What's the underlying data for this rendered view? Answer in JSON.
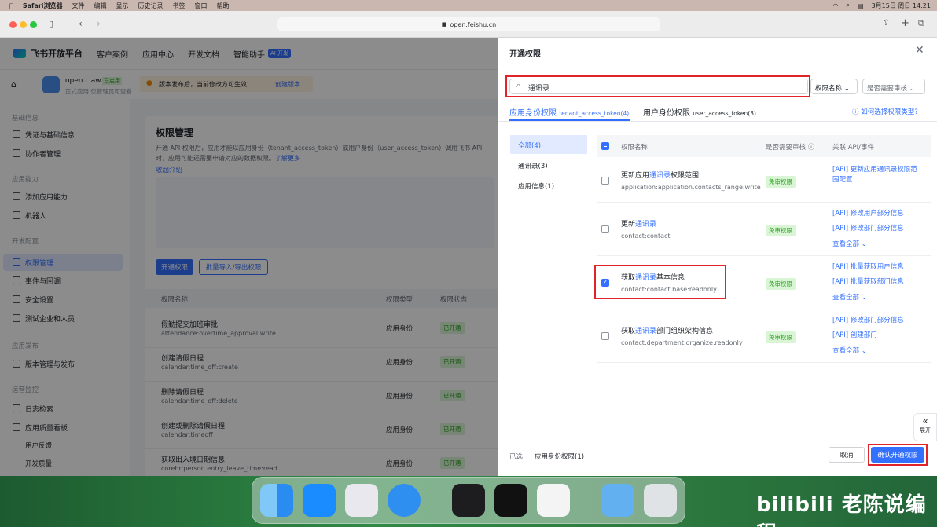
{
  "menubar": {
    "app": "Safari浏览器",
    "items": [
      "文件",
      "编辑",
      "显示",
      "历史记录",
      "书签",
      "窗口",
      "帮助"
    ],
    "clock": "3月15日 周日 14:21"
  },
  "browser": {
    "url": "open.feishu.cn"
  },
  "topnav": {
    "brand": "飞书开放平台",
    "items": [
      "客户案例",
      "应用中心",
      "开发文档",
      "智能助手"
    ],
    "ai_badge": "AI 开发"
  },
  "app": {
    "name": "open claw",
    "status": "已启用",
    "desc": "正式应用·仅管理员可查看",
    "notice": "版本发布后，当前修改方可生效",
    "create_version": "创建版本"
  },
  "sidebar": {
    "g1": "基础信息",
    "i1": "凭证与基础信息",
    "i2": "协作者管理",
    "g2": "应用能力",
    "i3": "添加应用能力",
    "i4": "机器人",
    "g3": "开发配置",
    "i5": "权限管理",
    "i6": "事件与回调",
    "i7": "安全设置",
    "i8": "测试企业和人员",
    "g4": "应用发布",
    "i9": "版本管理与发布",
    "g5": "运营监控",
    "i10": "日志检索",
    "i11": "应用质量看板",
    "i12": "用户反馈",
    "i13": "开发质量"
  },
  "content": {
    "title": "权限管理",
    "desc": "开通 API 权限后，应用才能以应用身份（tenant_access_token）或用户身份（user_access_token）调用飞书 API 时，应用可能还需要申请对应的数据权限。",
    "more": "了解更多",
    "collapse": "收起介绍",
    "btn_open": "开通权限",
    "btn_import": "批量导入/导出权限",
    "col_name": "权限名称",
    "col_type": "权限类型",
    "col_status": "权限状态",
    "rows": [
      {
        "name": "假勤提交加班审批",
        "code": "attendance:overtime_approval:write",
        "type": "应用身份",
        "status": "已开通"
      },
      {
        "name": "创建请假日程",
        "code": "calendar:time_off:create",
        "type": "应用身份",
        "status": "已开通"
      },
      {
        "name": "删除请假日程",
        "code": "calendar:time_off:delete",
        "type": "应用身份",
        "status": "已开通"
      },
      {
        "name": "创建或删除请假日程",
        "code": "calendar:timeoff",
        "type": "应用身份",
        "status": "已开通"
      },
      {
        "name": "获取出入境日期信息",
        "code": "corehr:person.entry_leave_time:read",
        "type": "应用身份",
        "status": "已开通"
      }
    ]
  },
  "drawer": {
    "title": "开通权限",
    "search": {
      "value": "通讯录"
    },
    "filter1": "权限名称",
    "filter2": "是否需要审核",
    "tab1": "应用身份权限",
    "tab1_sub": "tenant_access_token(4)",
    "tab2": "用户身份权限",
    "tab2_sub": "user_access_token(3)",
    "help": "如何选择权限类型?",
    "cats": [
      "全部(4)",
      "通讯录(3)",
      "应用信息(1)"
    ],
    "col_name": "权限名称",
    "col_review": "是否需要审核",
    "col_api": "关联 API/事件",
    "no_review": "免审权限",
    "view_all": "查看全部",
    "rows": [
      {
        "pre": "更新应用",
        "kw": "通讯录",
        "post": "权限范围",
        "code": "application:application.contacts_range:write",
        "apis": [
          "[API] 更新应用通讯录权限范围配置"
        ]
      },
      {
        "pre": "更新",
        "kw": "通讯录",
        "post": "",
        "code": "contact:contact",
        "apis": [
          "[API] 修改用户部分信息",
          "[API] 修改部门部分信息"
        ]
      },
      {
        "pre": "获取",
        "kw": "通讯录",
        "post": "基本信息",
        "code": "contact:contact.base:readonly",
        "apis": [
          "[API] 批量获取用户信息",
          "[API] 批量获取部门信息"
        ]
      },
      {
        "pre": "获取",
        "kw": "通讯录",
        "post": "部门组织架构信息",
        "code": "contact:department.organize:readonly",
        "apis": [
          "[API] 修改部门部分信息",
          "[API] 创建部门"
        ]
      }
    ],
    "selected_label": "已选:",
    "selected_value": "应用身份权限(1)",
    "cancel": "取消",
    "confirm": "确认开通权限",
    "expand": "展开"
  },
  "watermark": "老陈说编程"
}
